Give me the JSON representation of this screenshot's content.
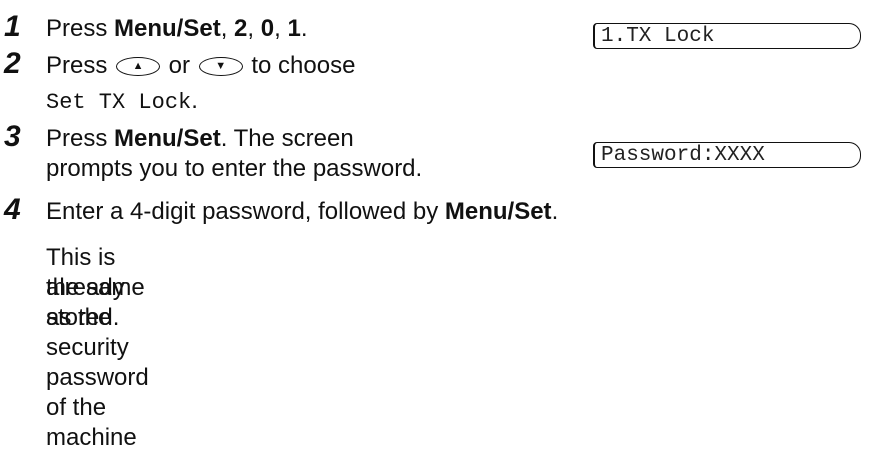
{
  "steps": [
    {
      "number": "1",
      "parts": {
        "press": "Press ",
        "key": "Menu/Set",
        "sep1": ", ",
        "d1": "2",
        "sep2": ", ",
        "d2": "0",
        "sep3": ", ",
        "d3": "1",
        "end": "."
      },
      "lcd": "1.TX Lock"
    },
    {
      "number": "2",
      "parts": {
        "press": "Press ",
        "up_icon": "up-arrow-key-icon",
        "or": " or ",
        "down_icon": "down-arrow-key-icon",
        "rest": " to choose",
        "option": "Set TX Lock",
        "end": "."
      }
    },
    {
      "number": "3",
      "parts": {
        "press": "Press ",
        "key": "Menu/Set",
        "rest": ". The screen",
        "line2": "prompts you to enter the password."
      },
      "lcd": "Password:XXXX"
    },
    {
      "number": "4",
      "parts": {
        "text": "Enter a 4-digit password, followed by ",
        "key": "Menu/Set",
        "end": "."
      },
      "note_line1": "This is the same as the security password of the machine",
      "note_line2": "already stored."
    }
  ]
}
